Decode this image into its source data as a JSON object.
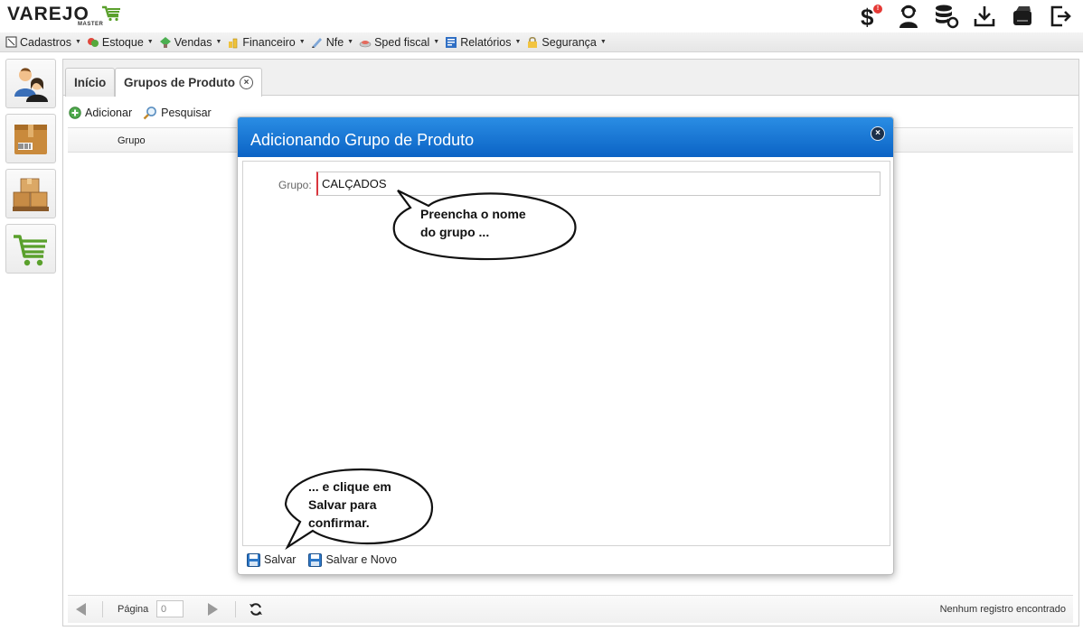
{
  "app": {
    "logo_text": "VAREJO",
    "logo_sub": "MASTER"
  },
  "top_icons": [
    {
      "icon": "dollar-icon",
      "badge": "!"
    },
    {
      "icon": "support-agent-icon"
    },
    {
      "icon": "database-settings-icon"
    },
    {
      "icon": "download-icon"
    },
    {
      "icon": "printer-icon"
    },
    {
      "icon": "logout-icon"
    }
  ],
  "menu": [
    {
      "label": "Cadastros",
      "icon": "cadastros-icon"
    },
    {
      "label": "Estoque",
      "icon": "estoque-icon"
    },
    {
      "label": "Vendas",
      "icon": "vendas-icon"
    },
    {
      "label": "Financeiro",
      "icon": "financeiro-icon"
    },
    {
      "label": "Nfe",
      "icon": "nfe-icon"
    },
    {
      "label": "Sped fiscal",
      "icon": "sped-icon"
    },
    {
      "label": "Relatórios",
      "icon": "relatorios-icon"
    },
    {
      "label": "Segurança",
      "icon": "seguranca-icon"
    }
  ],
  "launchers": [
    {
      "icon": "users-icon"
    },
    {
      "icon": "product-box-icon"
    },
    {
      "icon": "stock-boxes-icon"
    },
    {
      "icon": "shopping-cart-icon"
    }
  ],
  "tabs": [
    {
      "label": "Início",
      "closable": false
    },
    {
      "label": "Grupos de Produto",
      "closable": true,
      "active": true
    }
  ],
  "toolbar": {
    "add_label": "Adicionar",
    "search_label": "Pesquisar"
  },
  "grid": {
    "columns": [
      "Grupo"
    ]
  },
  "pager": {
    "page_label": "Página",
    "page_value": "0",
    "status": "Nenhum registro encontrado"
  },
  "modal": {
    "title": "Adicionando Grupo de Produto",
    "field_label": "Grupo:",
    "field_value": "CALÇADOS",
    "save_label": "Salvar",
    "save_new_label": "Salvar e Novo"
  },
  "bubbles": {
    "top": "Preencha o nome\ndo grupo ...",
    "bottom": "... e clique em\nSalvar para\nconfirmar."
  },
  "colors": {
    "modal_header_top": "#2a8de4",
    "modal_header_bottom": "#0b63c5",
    "required_field": "#d9363e",
    "logo_green": "#5aa02c"
  }
}
